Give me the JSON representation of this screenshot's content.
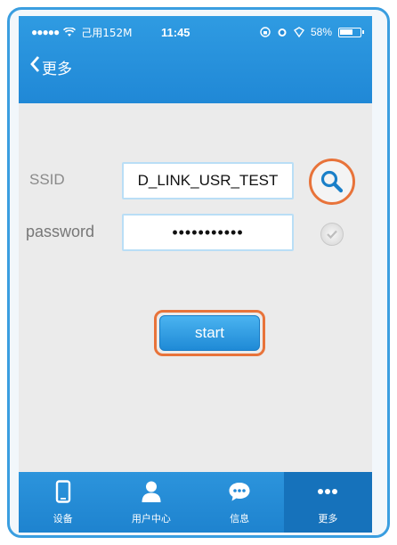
{
  "status_bar": {
    "signal": "●●●●●",
    "carrier": "己用152M",
    "time": "11:45",
    "battery_percent": "58%"
  },
  "nav": {
    "back_label": "更多"
  },
  "form": {
    "ssid_label": "SSID",
    "ssid_value": "D_LINK_USR_TEST",
    "password_label": "password",
    "password_value": "•••••••••••"
  },
  "start_button": {
    "label": "start"
  },
  "tabbar": {
    "items": [
      {
        "label": "设备",
        "icon": "phone-icon"
      },
      {
        "label": "用户中心",
        "icon": "user-icon"
      },
      {
        "label": "信息",
        "icon": "chat-icon"
      },
      {
        "label": "更多",
        "icon": "more-icon"
      }
    ],
    "active_index": 3
  },
  "colors": {
    "primary_blue": "#2088d6",
    "highlight_orange": "#e8733a",
    "background": "#ebebeb"
  }
}
